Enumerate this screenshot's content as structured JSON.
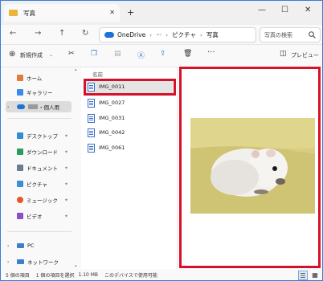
{
  "window": {
    "tab_title": "写真",
    "new_tab": "+",
    "minimize": "—",
    "maximize": "☐",
    "close": "✕"
  },
  "address": {
    "back": "←",
    "forward": "→",
    "up": "↑",
    "refresh": "↻",
    "path": [
      "OneDrive",
      "···",
      "ピクチャ",
      "写真"
    ],
    "chevron": "›",
    "search_placeholder": "写真の検索"
  },
  "toolbar": {
    "new_label": "新規作成",
    "more": "···",
    "preview_label": "プレビュー"
  },
  "sidebar": {
    "items": [
      {
        "label": "ホーム",
        "icon": "home-icon",
        "color": "#e07b39"
      },
      {
        "label": "ギャラリー",
        "icon": "gallery-icon",
        "color": "#3c8be6"
      },
      {
        "label": "・個人用",
        "icon": "onedrive-icon",
        "color": "#1a73d8"
      },
      {
        "label": "デスクトップ",
        "icon": "desktop-icon",
        "color": "#2d8dd6"
      },
      {
        "label": "ダウンロード",
        "icon": "download-icon",
        "color": "#2a9d5c"
      },
      {
        "label": "ドキュメント",
        "icon": "documents-icon",
        "color": "#6b7c93"
      },
      {
        "label": "ピクチャ",
        "icon": "pictures-icon",
        "color": "#3a8fd9"
      },
      {
        "label": "ミュージック",
        "icon": "music-icon",
        "color": "#e8572c"
      },
      {
        "label": "ビデオ",
        "icon": "video-icon",
        "color": "#8b4fc9"
      },
      {
        "label": "PC",
        "icon": "pc-icon",
        "color": "#3a7fd5"
      },
      {
        "label": "ネットワーク",
        "icon": "network-icon",
        "color": "#3a7fd5"
      }
    ]
  },
  "files": {
    "column_header": "名前",
    "items": [
      "IMG_0011",
      "IMG_0027",
      "IMG_0031",
      "IMG_0042",
      "IMG_0061"
    ],
    "selected": "IMG_0011"
  },
  "status": {
    "count": "5 個の項目",
    "selection": "1 個の項目を選択",
    "size": "1.10 MB",
    "availability": "このデバイスで使用可能"
  },
  "accent_colors": {
    "highlight": "#d6112a",
    "folder": "#e9b53a",
    "onedrive": "#1a73d8"
  }
}
